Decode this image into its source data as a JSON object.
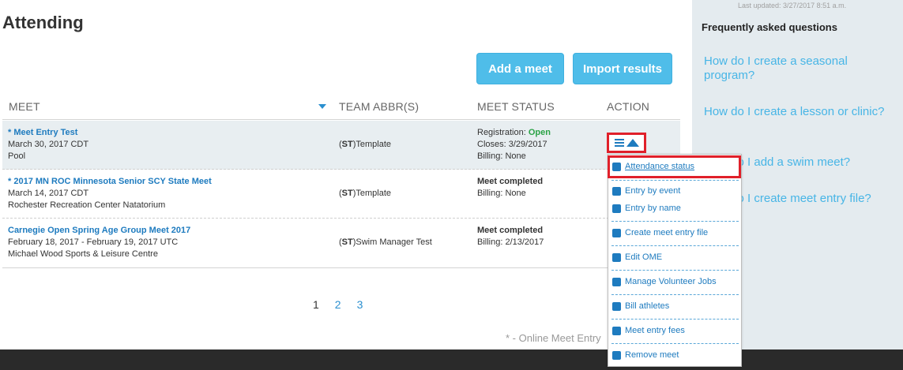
{
  "page": {
    "title": "Attending"
  },
  "buttons": {
    "add_meet": "Add a meet",
    "import_results": "Import results"
  },
  "table": {
    "headers": {
      "meet": "MEET",
      "team": "TEAM ABBR(S)",
      "status": "MEET STATUS",
      "action": "ACTION"
    },
    "rows": [
      {
        "name": "* Meet Entry Test",
        "date": "March 30, 2017 CDT",
        "venue": "Pool",
        "team_abbr": "ST",
        "team_name": "Template",
        "status_label": "Registration: ",
        "status_value": "Open",
        "closes": "Closes: 3/29/2017",
        "billing": "Billing: None"
      },
      {
        "name": "* 2017 MN ROC Minnesota Senior SCY State Meet",
        "date": "March 14, 2017 CDT",
        "venue": "Rochester Recreation Center Natatorium",
        "team_abbr": "ST",
        "team_name": "Template",
        "status": "Meet completed",
        "billing": "Billing: None"
      },
      {
        "name": "Carnegie Open Spring Age Group Meet 2017",
        "date": "February 18, 2017 - February 19, 2017 UTC",
        "venue": "Michael Wood Sports & Leisure Centre",
        "team_abbr": "ST",
        "team_name": "Swim Manager Test",
        "status": "Meet completed",
        "billing": "Billing: 2/13/2017"
      }
    ]
  },
  "pagination": {
    "current": "1",
    "pages": [
      "2",
      "3"
    ]
  },
  "footnote": "* - Online Meet Entry",
  "action_menu": {
    "items": [
      "Attendance status",
      "Entry by event",
      "Entry by name",
      "Create meet entry file",
      "Edit OME",
      "Manage Volunteer Jobs",
      "Bill athletes",
      "Meet entry fees",
      "Remove meet"
    ]
  },
  "sidebar": {
    "last_updated": "Last updated: 3/27/2017 8:51 a.m.",
    "faq_title": "Frequently asked questions",
    "faq_links": [
      "How do I create a seasonal program?",
      "How do I create a lesson or clinic?",
      "How do I add a swim meet?",
      "How do I create meet entry file?"
    ]
  },
  "colors": {
    "accent": "#4fbde9",
    "link": "#1e7bbf",
    "open_status": "#2ba346",
    "highlight_box": "#e0202a",
    "sidebar_bg": "#e4ebef"
  }
}
